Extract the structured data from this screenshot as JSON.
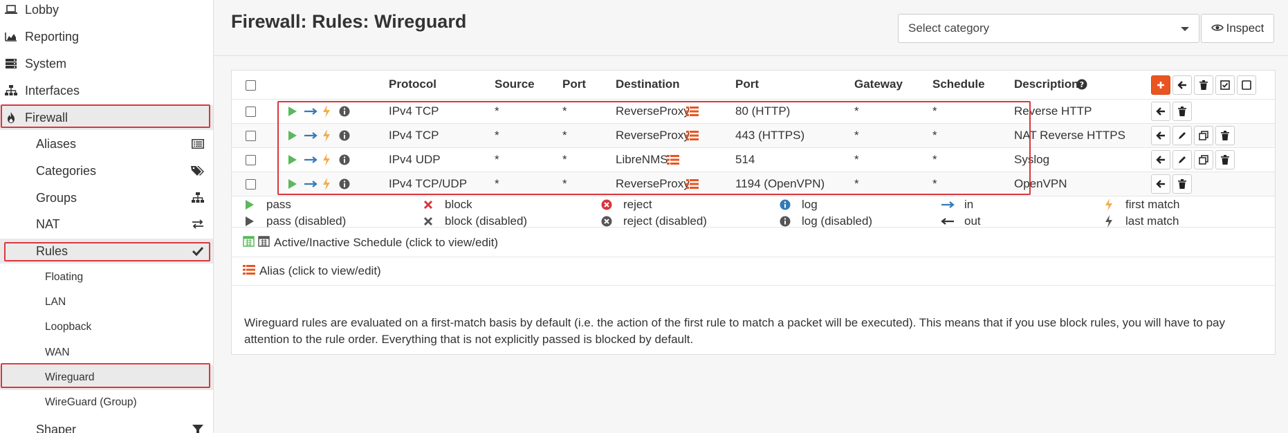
{
  "sidebar": {
    "top_items": [
      {
        "label": "Lobby",
        "icon": "laptop-icon"
      },
      {
        "label": "Reporting",
        "icon": "area-chart-icon"
      },
      {
        "label": "System",
        "icon": "server-icon"
      },
      {
        "label": "Interfaces",
        "icon": "sitemap-icon"
      },
      {
        "label": "Firewall",
        "icon": "fire-icon"
      }
    ],
    "firewall_items": [
      {
        "label": "Aliases",
        "icon": "list-alt-icon"
      },
      {
        "label": "Categories",
        "icon": "tags-icon"
      },
      {
        "label": "Groups",
        "icon": "sitemap-icon"
      },
      {
        "label": "NAT",
        "icon": "exchange-icon"
      },
      {
        "label": "Rules",
        "icon": "check-icon"
      }
    ],
    "rules_items": [
      {
        "label": "Floating"
      },
      {
        "label": "LAN"
      },
      {
        "label": "Loopback"
      },
      {
        "label": "WAN"
      },
      {
        "label": "Wireguard"
      },
      {
        "label": "WireGuard (Group)"
      }
    ],
    "shaper": {
      "label": "Shaper",
      "icon": "filter-icon"
    }
  },
  "page_title": "Firewall: Rules: Wireguard",
  "category_select": {
    "value": "Select category"
  },
  "inspect_label": "Inspect",
  "table": {
    "headers": [
      "Protocol",
      "Source",
      "Port",
      "Destination",
      "Port",
      "Gateway",
      "Schedule",
      "Description"
    ],
    "rows": [
      {
        "protocol": "IPv4 TCP",
        "source": "*",
        "src_port": "*",
        "destination": "ReverseProxy",
        "dst_port": "80 (HTTP)",
        "gateway": "*",
        "schedule": "*",
        "description": "Reverse HTTP",
        "actions": [
          "arrow-left-icon",
          "trash-icon"
        ]
      },
      {
        "protocol": "IPv4 TCP",
        "source": "*",
        "src_port": "*",
        "destination": "ReverseProxy",
        "dst_port": "443 (HTTPS)",
        "gateway": "*",
        "schedule": "*",
        "description": "NAT Reverse HTTPS",
        "actions": [
          "arrow-left-icon",
          "pencil-icon",
          "clone-icon",
          "trash-icon"
        ]
      },
      {
        "protocol": "IPv4 UDP",
        "source": "*",
        "src_port": "*",
        "destination": "LibreNMS",
        "dst_port": "514",
        "gateway": "*",
        "schedule": "*",
        "description": "Syslog",
        "actions": [
          "arrow-left-icon",
          "pencil-icon",
          "clone-icon",
          "trash-icon"
        ]
      },
      {
        "protocol": "IPv4 TCP/UDP",
        "source": "*",
        "src_port": "*",
        "destination": "ReverseProxy",
        "dst_port": "1194 (OpenVPN)",
        "gateway": "*",
        "schedule": "*",
        "description": "OpenVPN",
        "actions": [
          "arrow-left-icon",
          "trash-icon"
        ]
      }
    ]
  },
  "legend": {
    "row1": [
      "pass",
      "block",
      "reject",
      "log",
      "in",
      "first match"
    ],
    "row2": [
      "pass (disabled)",
      "block (disabled)",
      "reject (disabled)",
      "log (disabled)",
      "out",
      "last match"
    ],
    "schedule_note": "Active/Inactive Schedule (click to view/edit)",
    "alias_note": "Alias (click to view/edit)"
  },
  "info_text": "Wireguard rules are evaluated on a first-match basis by default (i.e. the action of the first rule to match a packet will be executed). This means that if you use block rules, you will have to pay attention to the rule order. Everything that is not explicitly passed is blocked by default.",
  "colors": {
    "accent": "#e95420",
    "pass": "#5cb85c",
    "block": "#d9363e",
    "info": "#337ab7",
    "highlight": "#d9363e"
  }
}
